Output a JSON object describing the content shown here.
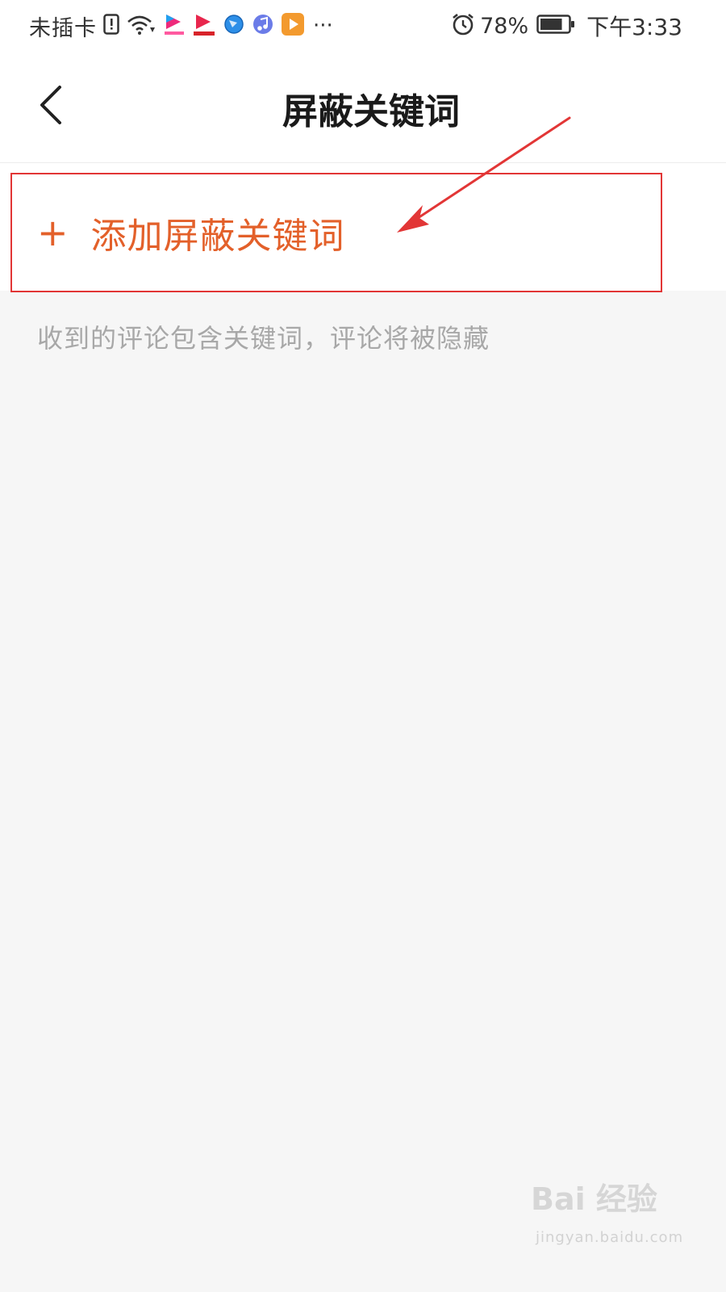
{
  "status_bar": {
    "carrier": "未插卡",
    "battery_percent": "78%",
    "battery_level": 0.78,
    "time": "下午3:33",
    "overflow": "···"
  },
  "nav": {
    "title": "屏蔽关键词"
  },
  "add_row": {
    "plus": "+",
    "label": "添加屏蔽关键词"
  },
  "hint": "收到的评论包含关键词，评论将被隐藏",
  "watermark": {
    "logo": "Bai 经验",
    "url": "jingyan.baidu.com"
  },
  "colors": {
    "accent": "#e3602a",
    "annotation": "#e23636",
    "background": "#f6f6f6"
  }
}
